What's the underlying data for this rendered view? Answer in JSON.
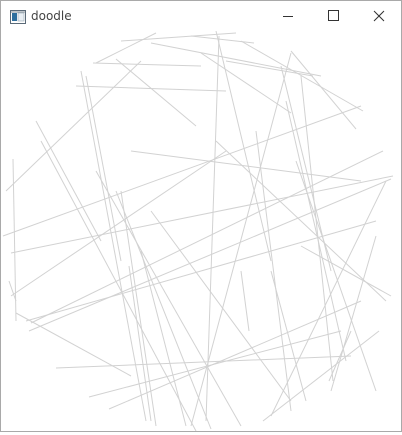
{
  "window": {
    "title": "doodle",
    "app_icon": "window-app-icon",
    "controls": [
      "minimize-icon",
      "maximize-icon",
      "close-icon"
    ]
  },
  "canvas": {
    "stroke_color": "#d2d2d2",
    "background": "#ffffff"
  }
}
